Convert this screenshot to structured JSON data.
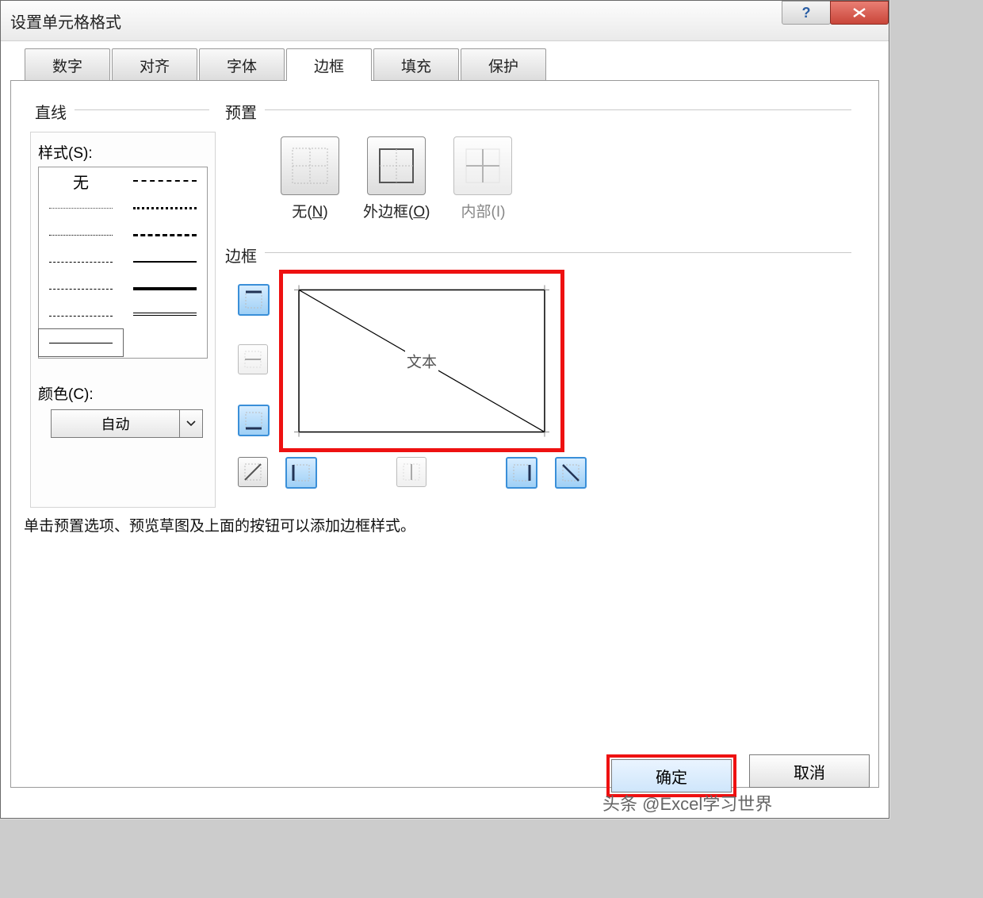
{
  "window": {
    "title": "设置单元格格式"
  },
  "tabs": [
    "数字",
    "对齐",
    "字体",
    "边框",
    "填充",
    "保护"
  ],
  "active_tab": "边框",
  "line_group_label": "直线",
  "style_label": "样式(S):",
  "style_none": "无",
  "color_label": "颜色(C):",
  "color_value": "自动",
  "preset_group_label": "预置",
  "presets": {
    "none": {
      "label": "无",
      "accel": "N"
    },
    "outline": {
      "label": "外边框",
      "accel": "O"
    },
    "inside": {
      "label": "内部",
      "accel": "I"
    }
  },
  "border_group_label": "边框",
  "preview_text": "文本",
  "hint": "单击预置选项、预览草图及上面的按钮可以添加边框样式。",
  "buttons": {
    "ok": "确定",
    "cancel": "取消"
  },
  "watermark": "头条 @Excel学习世界"
}
